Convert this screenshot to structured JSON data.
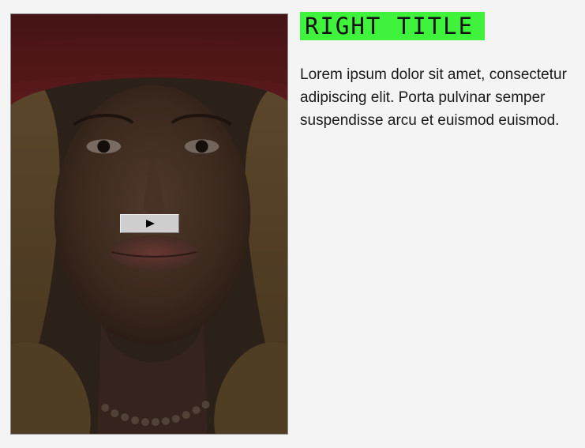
{
  "video": {
    "play_glyph": "play-icon"
  },
  "right_title": "RIGHT TITLE",
  "body_text": "Lorem ipsum dolor sit amet, consectetur adipiscing elit. Porta pulvinar semper suspendisse arcu et euismod euismod.",
  "colors": {
    "page_background": "#f4f4f4",
    "title_highlight": "#3ff23b",
    "button_face": "#cfcfcf"
  }
}
